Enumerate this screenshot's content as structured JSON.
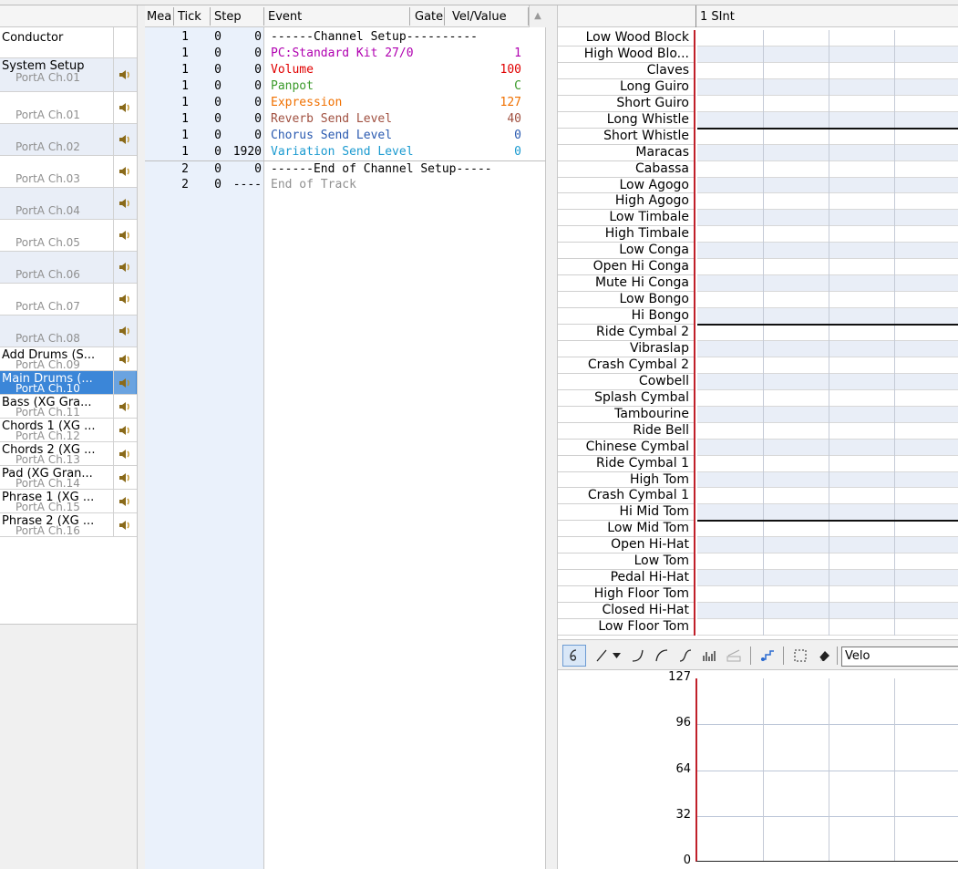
{
  "tracks": [
    {
      "name": "Conductor",
      "port": "",
      "style": "cond"
    },
    {
      "name": "System Setup",
      "port": "PortA  Ch.01",
      "style": "alt"
    },
    {
      "name": "",
      "port": "PortA  Ch.01",
      "style": ""
    },
    {
      "name": "",
      "port": "PortA  Ch.02",
      "style": "alt"
    },
    {
      "name": "",
      "port": "PortA  Ch.03",
      "style": ""
    },
    {
      "name": "",
      "port": "PortA  Ch.04",
      "style": "alt"
    },
    {
      "name": "",
      "port": "PortA  Ch.05",
      "style": ""
    },
    {
      "name": "",
      "port": "PortA  Ch.06",
      "style": "alt"
    },
    {
      "name": "",
      "port": "PortA  Ch.07",
      "style": ""
    },
    {
      "name": "",
      "port": "PortA  Ch.08",
      "style": "alt"
    },
    {
      "name": "Add Drums (S...",
      "port": "PortA  Ch.09",
      "style": ""
    },
    {
      "name": "Main Drums (...",
      "port": "PortA  Ch.10",
      "style": "sel"
    },
    {
      "name": "Bass (XG Gra...",
      "port": "PortA  Ch.11",
      "style": ""
    },
    {
      "name": "Chords 1 (XG ...",
      "port": "PortA  Ch.12",
      "style": ""
    },
    {
      "name": "Chords 2 (XG ...",
      "port": "PortA  Ch.13",
      "style": ""
    },
    {
      "name": "Pad (XG Gran...",
      "port": "PortA  Ch.14",
      "style": ""
    },
    {
      "name": "Phrase 1 (XG ...",
      "port": "PortA  Ch.15",
      "style": ""
    },
    {
      "name": "Phrase 2 (XG ...",
      "port": "PortA  Ch.16",
      "style": ""
    }
  ],
  "event_list": {
    "headers": {
      "mea": "Mea",
      "tick": "Tick",
      "step": "Step",
      "event": "Event",
      "gate": "Gate",
      "value": "Vel/Value"
    },
    "rows": [
      {
        "mea": "1",
        "tick": "0",
        "step": "0",
        "event": "------Channel Setup----------",
        "value": "",
        "color": "#000000"
      },
      {
        "mea": "1",
        "tick": "0",
        "step": "0",
        "event": "PC:Standard Kit 27/0",
        "value": "1",
        "color": "#b000b0"
      },
      {
        "mea": "1",
        "tick": "0",
        "step": "0",
        "event": "Volume",
        "value": "100",
        "color": "#e00000"
      },
      {
        "mea": "1",
        "tick": "0",
        "step": "0",
        "event": "Panpot",
        "value": "C",
        "color": "#3a9a2a"
      },
      {
        "mea": "1",
        "tick": "0",
        "step": "0",
        "event": "Expression",
        "value": "127",
        "color": "#f07000"
      },
      {
        "mea": "1",
        "tick": "0",
        "step": "0",
        "event": "Reverb Send Level",
        "value": "40",
        "color": "#a05040"
      },
      {
        "mea": "1",
        "tick": "0",
        "step": "0",
        "event": "Chorus Send Level",
        "value": "0",
        "color": "#2a5ab0"
      },
      {
        "mea": "1",
        "tick": "0",
        "step": "1920",
        "event": "Variation Send Level",
        "value": "0",
        "color": "#1a9ad0"
      },
      {
        "mea": "2",
        "tick": "0",
        "step": "0",
        "event": "------End of Channel Setup-----",
        "value": "",
        "color": "#000000"
      },
      {
        "mea": "2",
        "tick": "0",
        "step": "----",
        "event": "End of Track",
        "value": "",
        "color": "#909090"
      }
    ]
  },
  "drum_editor": {
    "ruler_label": "1 SInt",
    "instruments": [
      "Low Wood Block",
      "High Wood Blo...",
      "Claves",
      "Long Guiro",
      "Short Guiro",
      "Long Whistle",
      "Short Whistle",
      "Maracas",
      "Cabassa",
      "Low Agogo",
      "High Agogo",
      "Low Timbale",
      "High Timbale",
      "Low Conga",
      "Open Hi Conga",
      "Mute Hi Conga",
      "Low Bongo",
      "Hi Bongo",
      "Ride Cymbal 2",
      "Vibraslap",
      "Crash Cymbal 2",
      "Cowbell",
      "Splash Cymbal",
      "Tambourine",
      "Ride Bell",
      "Chinese Cymbal",
      "Ride Cymbal 1",
      "High Tom",
      "Crash Cymbal 1",
      "Hi Mid Tom",
      "Low Mid Tom",
      "Open Hi-Hat",
      "Low Tom",
      "Pedal Hi-Hat",
      "High Floor Tom",
      "Closed Hi-Hat",
      "Low Floor Tom"
    ],
    "toolbar": {
      "tools": [
        "select-pointer-icon",
        "line-tool-icon",
        "dropdown-arrow-icon",
        "curve-tool-1-icon",
        "curve-tool-2-icon",
        "curve-tool-3-icon",
        "random-tool-icon",
        "ramp-tool-icon",
        "step-tool-icon",
        "selection-box-icon",
        "eraser-icon"
      ],
      "select_value": "Velo"
    },
    "velocity_labels": [
      "127",
      "96",
      "64",
      "32",
      "0"
    ]
  }
}
